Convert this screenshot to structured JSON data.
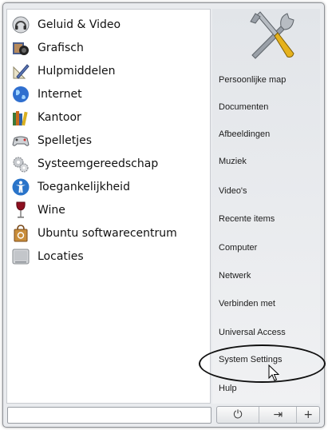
{
  "categories": [
    {
      "label": "Geluid & Video",
      "icon": "headphones-icon"
    },
    {
      "label": "Grafisch",
      "icon": "camera-icon"
    },
    {
      "label": "Hulpmiddelen",
      "icon": "ruler-pencil-icon"
    },
    {
      "label": "Internet",
      "icon": "globe-icon"
    },
    {
      "label": "Kantoor",
      "icon": "books-icon"
    },
    {
      "label": "Spelletjes",
      "icon": "gamepad-icon"
    },
    {
      "label": "Systeemgereedschap",
      "icon": "gears-icon"
    },
    {
      "label": "Toegankelijkheid",
      "icon": "accessibility-icon"
    },
    {
      "label": "Wine",
      "icon": "wine-glass-icon"
    },
    {
      "label": "Ubuntu softwarecentrum",
      "icon": "shopping-bag-icon"
    },
    {
      "label": "Locaties",
      "icon": "drive-icon"
    }
  ],
  "places": [
    {
      "label": "Persoonlijke map"
    },
    {
      "label": "Documenten"
    },
    {
      "label": "Afbeeldingen"
    },
    {
      "label": "Muziek"
    },
    {
      "label": "Video's"
    },
    {
      "label": "Recente items"
    },
    {
      "label": "Computer"
    },
    {
      "label": "Netwerk"
    },
    {
      "label": "Verbinden met"
    },
    {
      "label": "Universal Access"
    },
    {
      "label": "System Settings"
    },
    {
      "label": "Hulp"
    }
  ],
  "search": {
    "value": "",
    "placeholder": ""
  },
  "buttons": {
    "power": {
      "glyph": "⏻",
      "icon": "power-icon"
    },
    "logout": {
      "glyph": "⇥",
      "icon": "logout-icon"
    },
    "add": {
      "glyph": "+",
      "icon": "plus-icon"
    }
  },
  "colors": {
    "highlight": "#101010",
    "pane": "#ffffff",
    "frame": "#e9ebee"
  }
}
